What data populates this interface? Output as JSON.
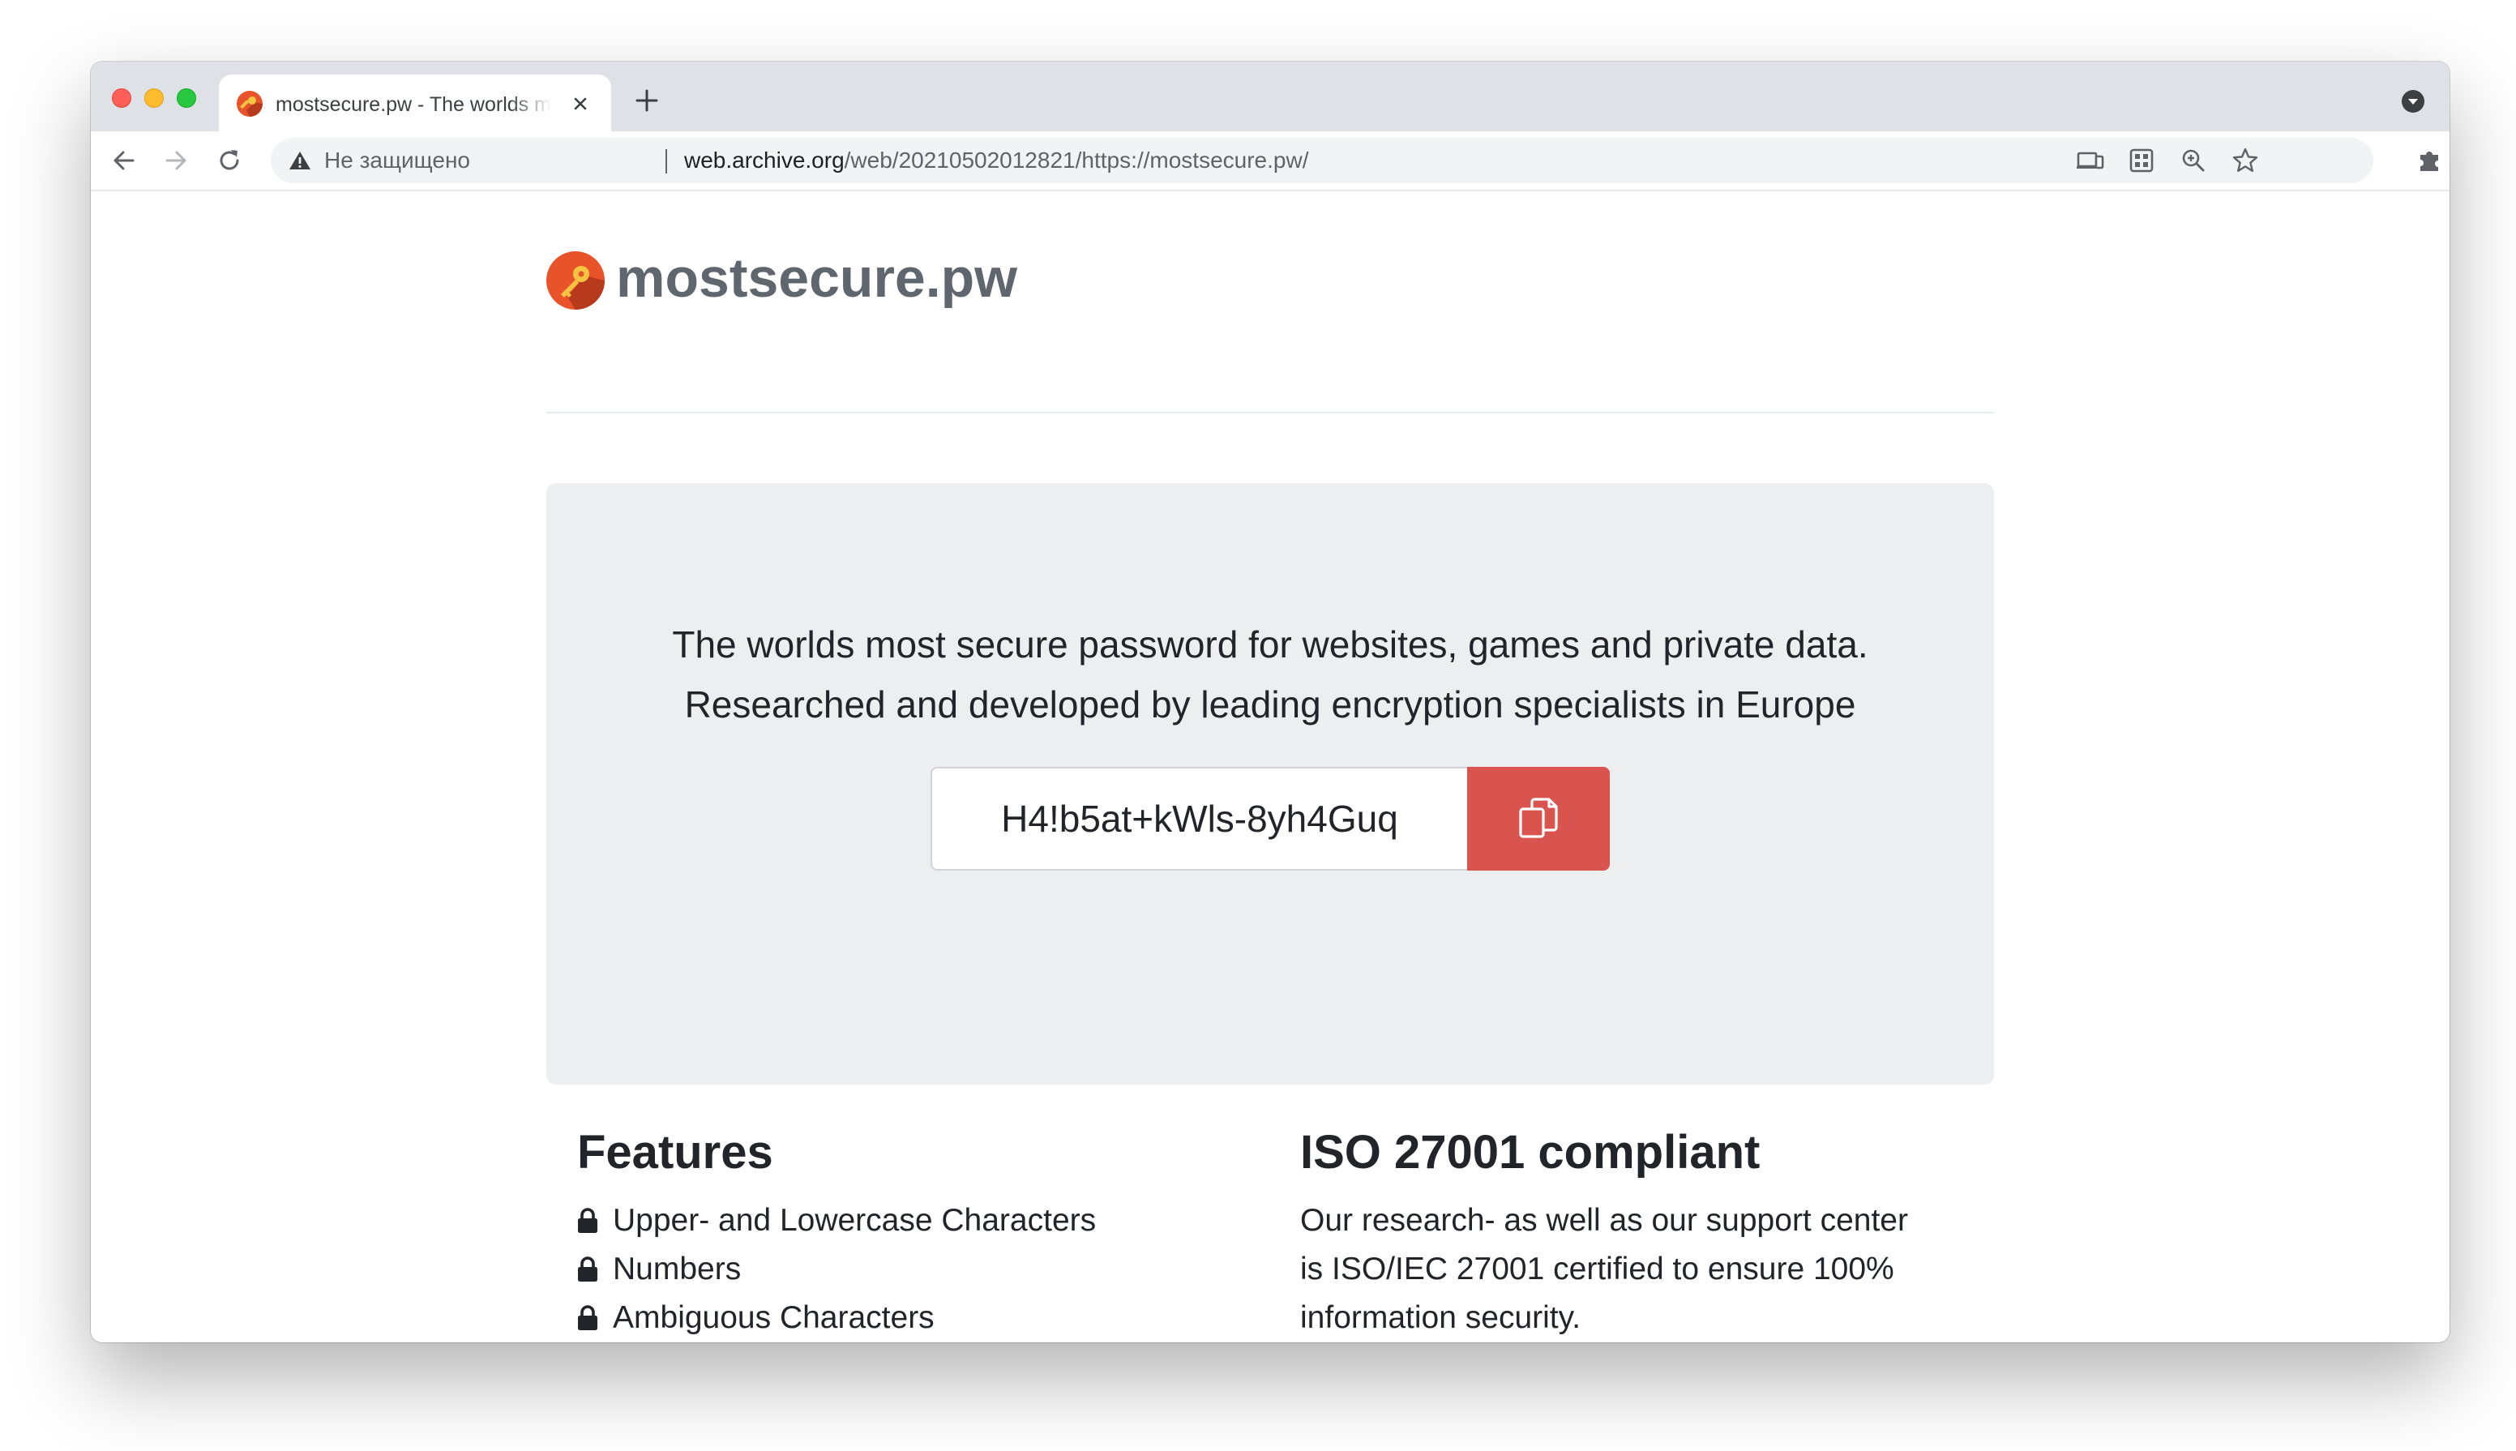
{
  "browser": {
    "tab": {
      "title": "mostsecure.pw - The worlds most secure password"
    },
    "omnibox": {
      "security_label": "Не защищено",
      "url_host": "web.archive.org",
      "url_path": "/web/20210502012821/https://mostsecure.pw/"
    }
  },
  "site": {
    "brand": "mostsecure.pw",
    "brand_color": "#e8532a",
    "hero": {
      "line1": "The worlds most secure password for websites, games and private data.",
      "line2": "Researched and developed by leading encryption specialists in Europe",
      "password": "H4!b5at+kWls-8yh4Guq",
      "copy_button_color": "#d9534f",
      "copy_icon": "copy-icon"
    },
    "features": {
      "title": "Features",
      "items": [
        {
          "label": "Upper- and Lowercase Characters",
          "icon": "lock-icon"
        },
        {
          "label": "Numbers",
          "icon": "lock-icon"
        },
        {
          "label": "Ambiguous Characters",
          "icon": "lock-icon"
        }
      ]
    },
    "iso": {
      "title": "ISO 27001 compliant",
      "lines": [
        "Our research- as well as our support center",
        "is ISO/IEC 27001 certified to ensure 100%",
        "information security."
      ]
    }
  }
}
